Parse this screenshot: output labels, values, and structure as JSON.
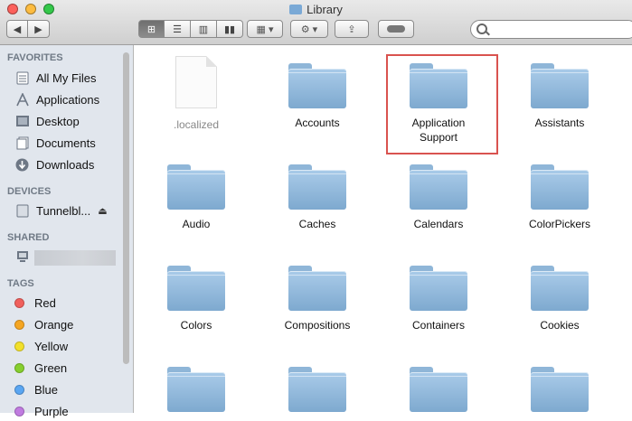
{
  "window": {
    "title": "Library"
  },
  "search": {
    "value": "",
    "placeholder": ""
  },
  "sidebar": {
    "favorites_header": "FAVORITES",
    "favorites": [
      "All My Files",
      "Applications",
      "Desktop",
      "Documents",
      "Downloads"
    ],
    "devices_header": "DEVICES",
    "devices": [
      "Tunnelbl..."
    ],
    "shared_header": "SHARED",
    "tags_header": "TAGS",
    "tags": [
      {
        "label": "Red",
        "color": "#f0605c"
      },
      {
        "label": "Orange",
        "color": "#f5a623"
      },
      {
        "label": "Yellow",
        "color": "#f2e02b"
      },
      {
        "label": "Green",
        "color": "#86cf2e"
      },
      {
        "label": "Blue",
        "color": "#5aa6f2"
      },
      {
        "label": "Purple",
        "color": "#c07be0"
      }
    ]
  },
  "files": [
    {
      "name": ".localized",
      "kind": "document"
    },
    {
      "name": "Accounts",
      "kind": "folder"
    },
    {
      "name": "Application Support",
      "kind": "folder",
      "highlighted": true
    },
    {
      "name": "Assistants",
      "kind": "folder"
    },
    {
      "name": "Audio",
      "kind": "folder"
    },
    {
      "name": "Caches",
      "kind": "folder"
    },
    {
      "name": "Calendars",
      "kind": "folder"
    },
    {
      "name": "ColorPickers",
      "kind": "folder"
    },
    {
      "name": "Colors",
      "kind": "folder"
    },
    {
      "name": "Compositions",
      "kind": "folder"
    },
    {
      "name": "Containers",
      "kind": "folder"
    },
    {
      "name": "Cookies",
      "kind": "folder"
    },
    {
      "name": "",
      "kind": "folder"
    },
    {
      "name": "",
      "kind": "folder"
    },
    {
      "name": "",
      "kind": "folder"
    },
    {
      "name": "",
      "kind": "folder"
    }
  ],
  "colors": {
    "highlight_border": "#d9534f",
    "folder": "#8fb6d8"
  }
}
